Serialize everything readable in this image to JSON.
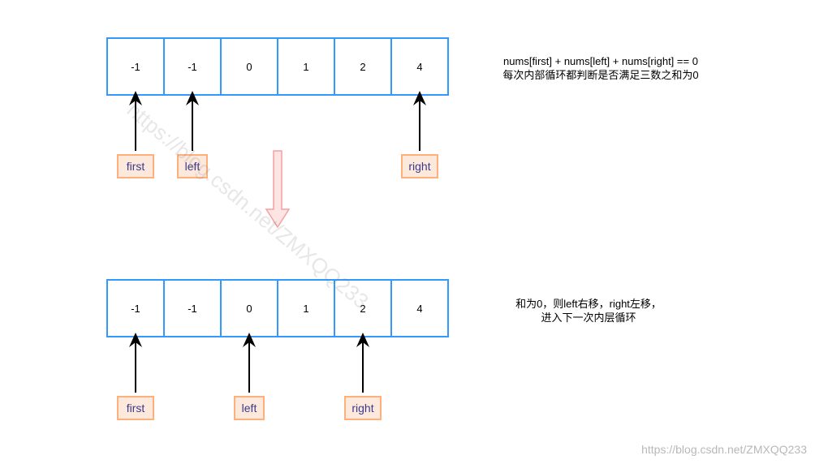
{
  "top": {
    "values": [
      "-1",
      "-1",
      "0",
      "1",
      "2",
      "4"
    ],
    "pointers": [
      {
        "label": "first",
        "index": 0
      },
      {
        "label": "left",
        "index": 1
      },
      {
        "label": "right",
        "index": 5
      }
    ],
    "note_line1": "nums[first] + nums[left] + nums[right] == 0",
    "note_line2": "每次内部循环都判断是否满足三数之和为0"
  },
  "bottom": {
    "values": [
      "-1",
      "-1",
      "0",
      "1",
      "2",
      "4"
    ],
    "pointers": [
      {
        "label": "first",
        "index": 0
      },
      {
        "label": "left",
        "index": 2
      },
      {
        "label": "right",
        "index": 4
      }
    ],
    "note_line1": "和为0，则left右移，right左移，",
    "note_line2": "进入下一次内层循环"
  },
  "watermark": "https://blog.csdn.net/ZMXQQ233",
  "colors": {
    "cell_border": "#3399ff",
    "label_border": "#ffb07a",
    "label_fill": "#fde9dc",
    "label_text": "#3a3a8c",
    "transition_arrow_fill": "#fde5e5",
    "transition_arrow_stroke": "#f5a0a0"
  }
}
